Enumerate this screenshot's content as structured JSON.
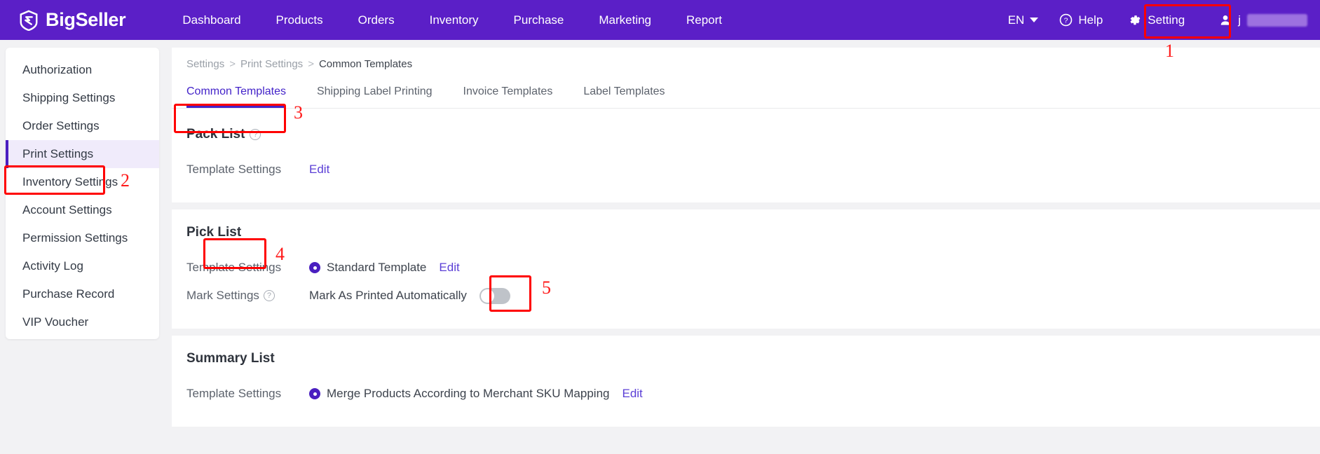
{
  "brand": {
    "name": "BigSeller",
    "icon": "bigseller-logo-icon"
  },
  "topnav": {
    "items": [
      {
        "label": "Dashboard"
      },
      {
        "label": "Products"
      },
      {
        "label": "Orders"
      },
      {
        "label": "Inventory"
      },
      {
        "label": "Purchase"
      },
      {
        "label": "Marketing"
      },
      {
        "label": "Report"
      }
    ],
    "language": "EN",
    "help": "Help",
    "setting": "Setting",
    "user": "j",
    "colors": {
      "bar": "#5b1fc7",
      "text": "#ffffff"
    }
  },
  "sidebar": {
    "items": [
      {
        "label": "Authorization",
        "active": false
      },
      {
        "label": "Shipping Settings",
        "active": false
      },
      {
        "label": "Order Settings",
        "active": false
      },
      {
        "label": "Print Settings",
        "active": true
      },
      {
        "label": "Inventory Settings",
        "active": false
      },
      {
        "label": "Account Settings",
        "active": false
      },
      {
        "label": "Permission Settings",
        "active": false
      },
      {
        "label": "Activity Log",
        "active": false
      },
      {
        "label": "Purchase Record",
        "active": false
      },
      {
        "label": "VIP Voucher",
        "active": false
      }
    ],
    "active_color": "#4a1fc0",
    "active_bg": "#f0ebfb"
  },
  "breadcrumb": {
    "root": "Settings",
    "sep": ">",
    "mid": "Print Settings",
    "current": "Common Templates"
  },
  "tabs": [
    {
      "label": "Common Templates",
      "active": true
    },
    {
      "label": "Shipping Label Printing",
      "active": false
    },
    {
      "label": "Invoice Templates",
      "active": false
    },
    {
      "label": "Label Templates",
      "active": false
    }
  ],
  "sections": {
    "pack_list": {
      "title": "Pack List",
      "help_icon": "question-mark-icon",
      "row_label": "Template Settings",
      "edit": "Edit"
    },
    "pick_list": {
      "title": "Pick List",
      "template_label": "Template Settings",
      "template_option": "Standard Template",
      "template_edit": "Edit",
      "mark_label": "Mark Settings",
      "mark_help_icon": "question-mark-icon",
      "mark_option": "Mark As Printed Automatically",
      "mark_toggle_state": "off"
    },
    "summary_list": {
      "title": "Summary List",
      "row_label": "Template Settings",
      "option": "Merge Products According to Merchant SKU Mapping",
      "edit": "Edit"
    }
  },
  "annotations": {
    "color": "#ff0000",
    "markers": [
      {
        "num": "1",
        "target": "setting-nav-button"
      },
      {
        "num": "2",
        "target": "sidebar-item-print-settings"
      },
      {
        "num": "3",
        "target": "tab-common-templates"
      },
      {
        "num": "4",
        "target": "pick-list-title"
      },
      {
        "num": "5",
        "target": "pick-list-edit-link"
      }
    ]
  }
}
